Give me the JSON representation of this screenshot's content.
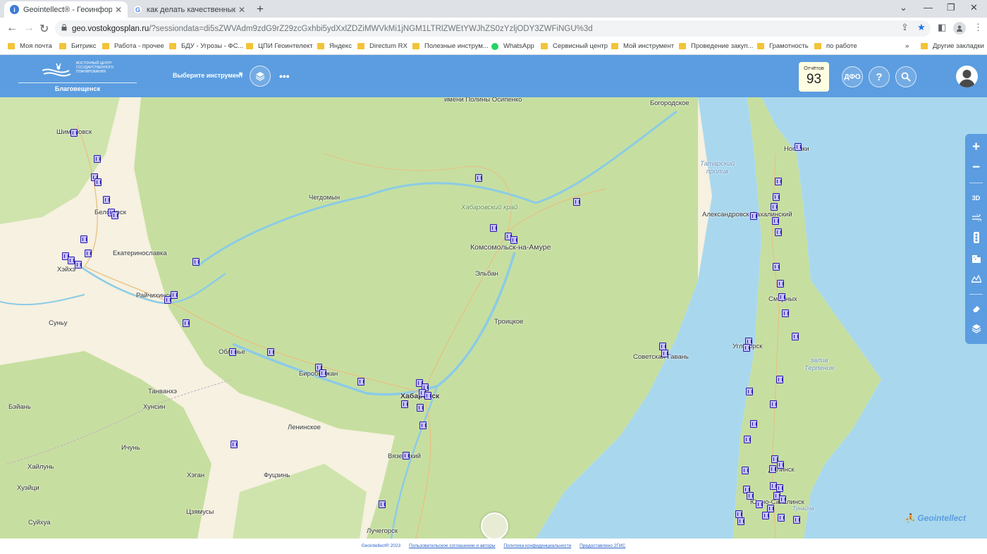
{
  "browser": {
    "tabs": [
      {
        "title": "Geointellect® - Геоинформацио",
        "active": true
      },
      {
        "title": "как делать качественные сним",
        "active": false
      }
    ],
    "url_host": "geo.vostokgosplan.ru",
    "url_path": "/?sessiondata=di5sZWVAdm9zdG9rZ29zcGxhbi5ydXxlZDZiMWVkMi1jNGM1LTRlZWEtYWJhZS0zYzljODY3ZWFiNGU%3d",
    "bookmarks": [
      "Моя почта",
      "Битрикс",
      "Работа - прочее",
      "БДУ - Угрозы - ФС...",
      "ЦПИ Геоинтелект",
      "Яндекс",
      "Directum RX",
      "Полезные инструм...",
      "WhatsApp",
      "Сервисный центр",
      "Мой инструмент",
      "Проведение закуп...",
      "Грамотность",
      "по работе"
    ],
    "bookmarks_more": "»",
    "bookmarks_other": "Другие закладки"
  },
  "app": {
    "logo_text": "ВОСТОЧНЫЙ ЦЕНТР ГОСУДАРСТВЕННОГО ПЛАНИРОВАНИЯ",
    "city": "Благовещенск",
    "tool_select": "Выберите инструмент",
    "reports_label": "Отчётов",
    "reports_count": "93",
    "district_button": "ДФО",
    "help_button": "?",
    "brand_color": "#5b9de0"
  },
  "map": {
    "places": [
      {
        "name": "имени Полины Осипенко"
      },
      {
        "name": "Богородское"
      },
      {
        "name": "Шимановск"
      },
      {
        "name": "Ноглики"
      },
      {
        "name": "Чегдомын"
      },
      {
        "name": "Белогорск"
      },
      {
        "name": "Екатеринославка"
      },
      {
        "name": "Хэйхэ"
      },
      {
        "name": "Хабаровский край"
      },
      {
        "name": "Александровск-Сахалинский"
      },
      {
        "name": "Комсомольск-на-Амуре"
      },
      {
        "name": "Эльбан"
      },
      {
        "name": "Райчихинск"
      },
      {
        "name": "Суньу"
      },
      {
        "name": "Смирных"
      },
      {
        "name": "Троицкое"
      },
      {
        "name": "Облучье"
      },
      {
        "name": "Советская Гавань"
      },
      {
        "name": "Углегорск"
      },
      {
        "name": "Биробиджан"
      },
      {
        "name": "Хабаровск"
      },
      {
        "name": "Танванхэ"
      },
      {
        "name": "Хунсин"
      },
      {
        "name": "Бэйань"
      },
      {
        "name": "Ленинское"
      },
      {
        "name": "Ичунь"
      },
      {
        "name": "Вяземский"
      },
      {
        "name": "Хайлунь"
      },
      {
        "name": "Хэган"
      },
      {
        "name": "Фуцзинь"
      },
      {
        "name": "Хуэйци"
      },
      {
        "name": "Долинск"
      },
      {
        "name": "Южно-Сахалинск"
      },
      {
        "name": "Суйхуа"
      },
      {
        "name": "Цзямусы"
      },
      {
        "name": "Лучегорск"
      }
    ],
    "water_labels": [
      "Татарский пролив",
      "залив Терпения",
      "Тунайча"
    ]
  },
  "map_controls": {
    "zoom_in": "+",
    "zoom_out": "−",
    "mode_3d": "3D"
  },
  "brand": "Geointellect",
  "footer": {
    "copyright": "Geointellect® 2023",
    "links": [
      "Пользовательское соглашение и авторы",
      "Политика конфиденциальности",
      "Предоставлено 2ГИС"
    ]
  }
}
